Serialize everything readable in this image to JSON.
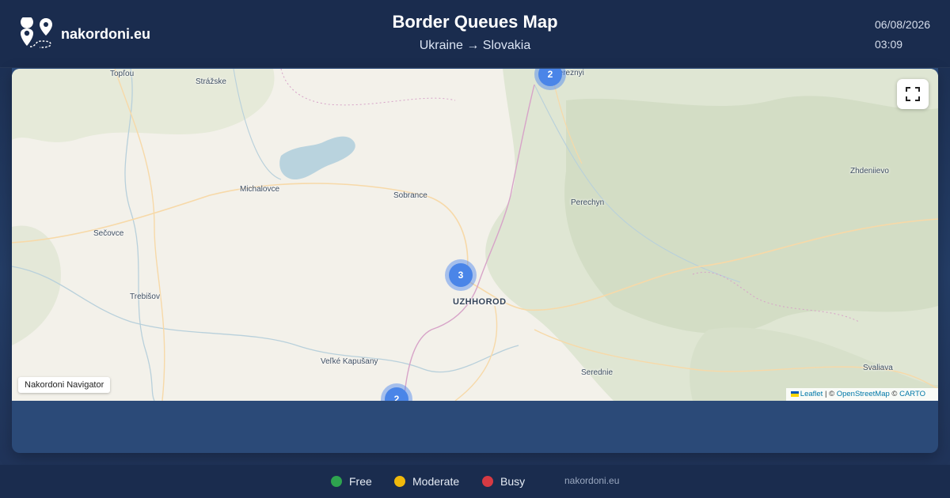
{
  "header": {
    "brand": "nakordoni.eu",
    "title": "Border Queues Map",
    "route": "Ukraine → Slovakia",
    "date": "06/08/2026",
    "time": "03:09"
  },
  "map": {
    "places": [
      {
        "name": "Topľou"
      },
      {
        "name": "Strážske"
      },
      {
        "name": "Michalovce"
      },
      {
        "name": "Sobrance"
      },
      {
        "name": "Sečovce"
      },
      {
        "name": "Trebišov"
      },
      {
        "name": "Perechyn"
      },
      {
        "name": "Zhdeniievo"
      },
      {
        "name": "UZHHOROD"
      },
      {
        "name": "Veľké Kapušany"
      },
      {
        "name": "Serednie"
      },
      {
        "name": "Svaliava"
      },
      {
        "name": "Bereznyi"
      }
    ],
    "clusters": [
      {
        "count": "2"
      },
      {
        "count": "3"
      },
      {
        "count": "2"
      }
    ],
    "nav_label": "Nakordoni Navigator",
    "attribution": {
      "leaflet": "Leaflet",
      "sep": " | © ",
      "osm": "OpenStreetMap",
      "carto_prefix": " © ",
      "carto": "CARTO"
    }
  },
  "legend": [
    {
      "label": "Free",
      "color": "#2ea44f"
    },
    {
      "label": "Moderate",
      "color": "#f0b90b"
    },
    {
      "label": "Busy",
      "color": "#d63a43"
    }
  ],
  "footer": {
    "site": "nakordoni.eu"
  }
}
